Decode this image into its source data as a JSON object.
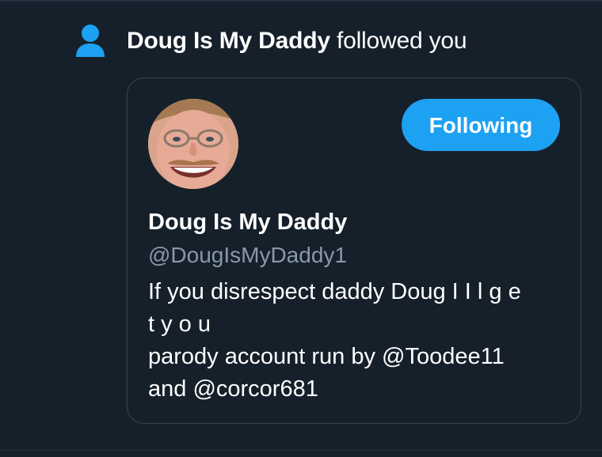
{
  "notification": {
    "icon": "person-icon",
    "actor": "Doug Is My Daddy",
    "action": "followed you",
    "icon_color": "#1da1f2"
  },
  "profile_card": {
    "avatar_icon": "profile-photo",
    "follow_button_label": "Following",
    "display_name": "Doug Is My Daddy",
    "handle": "@DougIsMyDaddy1",
    "bio_lines": [
      "If you disrespect daddy Doug I I l g e",
      "t y o u",
      "parody account run by @Toodee11",
      "and @corcor681"
    ]
  },
  "colors": {
    "background": "#15202b",
    "accent": "#1da1f2",
    "secondary_text": "#8899a6",
    "border": "#38444d"
  }
}
